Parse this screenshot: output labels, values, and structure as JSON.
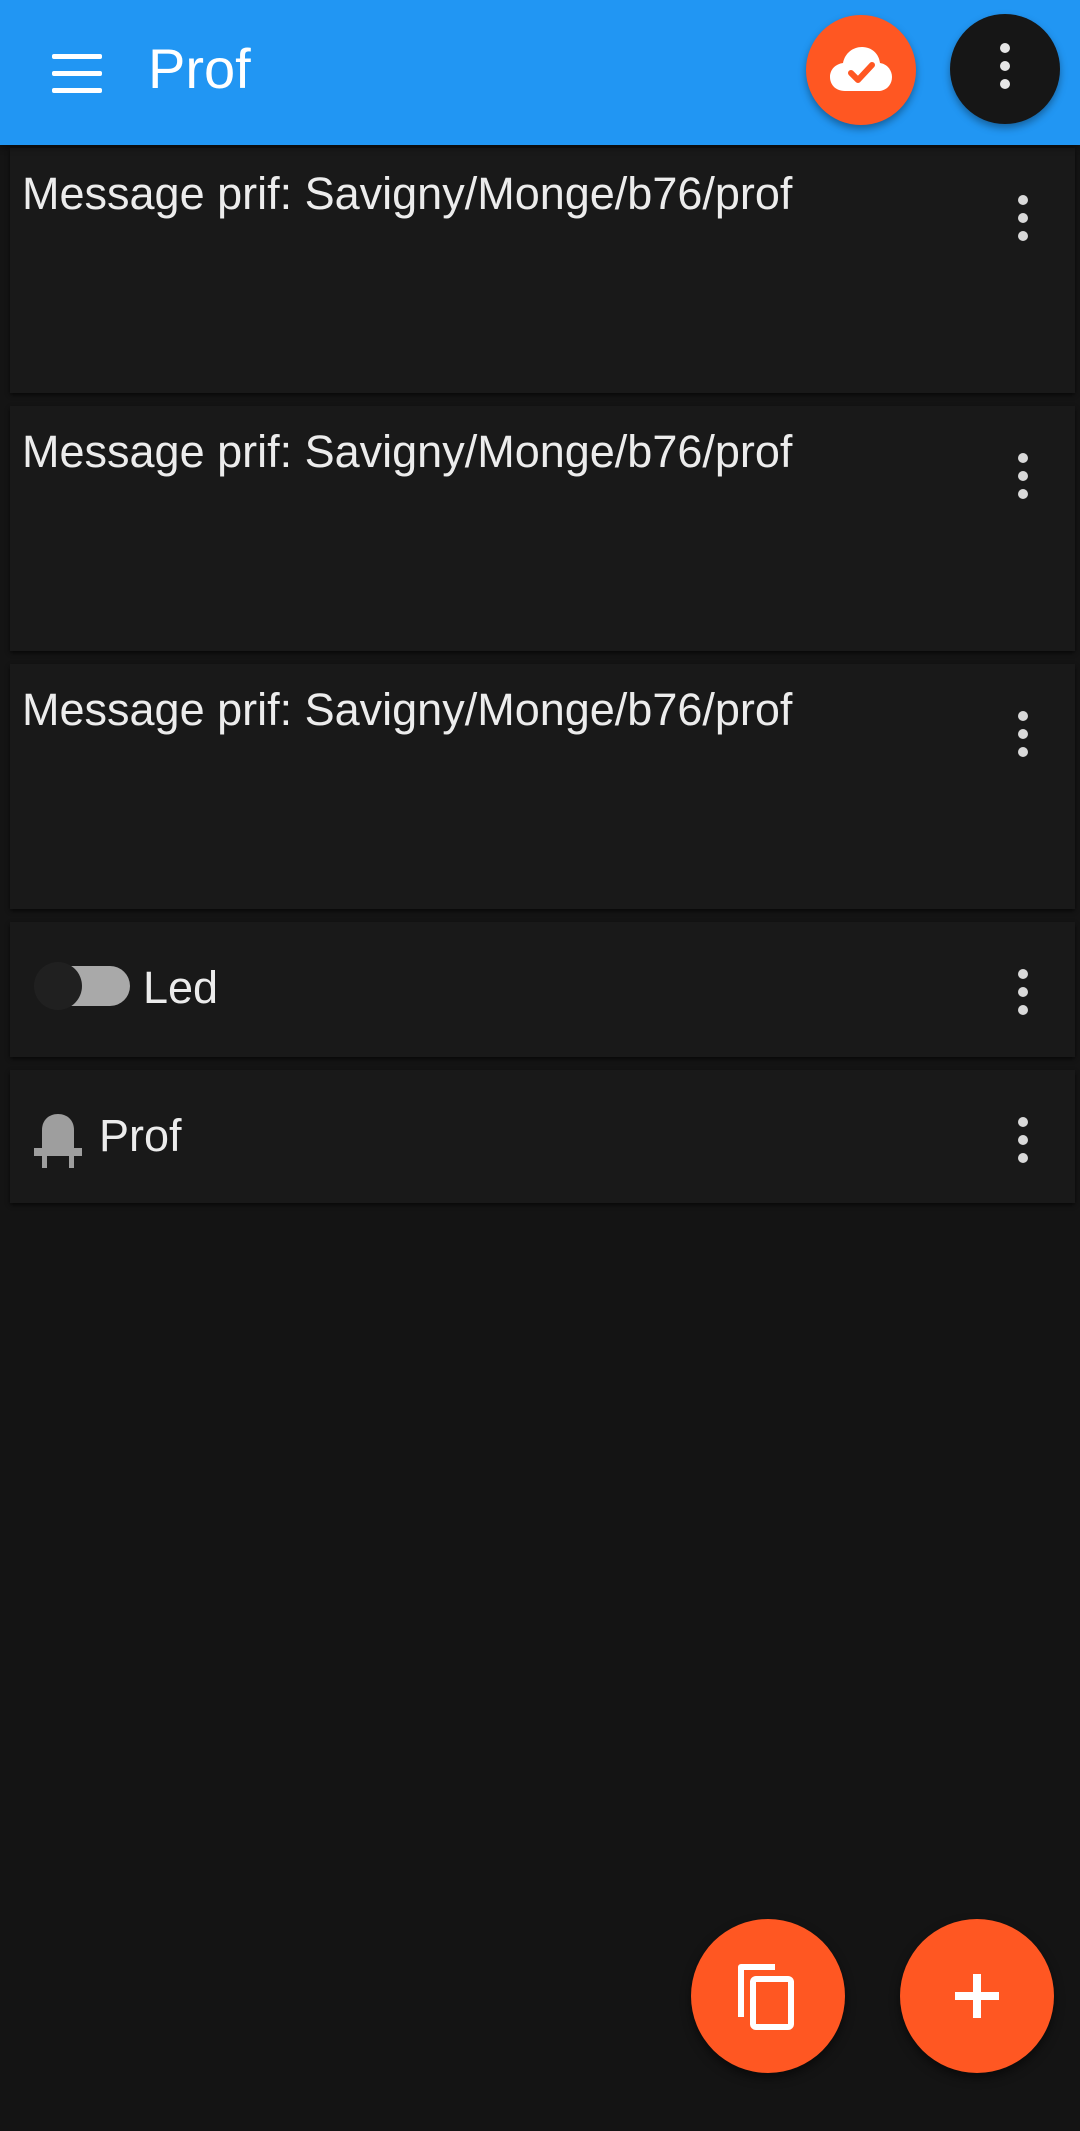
{
  "app_bar": {
    "title": "Prof",
    "menu_icon": "hamburger-menu-icon",
    "cloud_icon": "cloud-check-icon",
    "overflow_icon": "more-vertical-icon",
    "color": "#2196F3",
    "accent": "#FF5722"
  },
  "cards": [
    {
      "type": "message",
      "text": "Message prif: Savigny/Monge/b76/prof"
    },
    {
      "type": "message",
      "text": "Message prif: Savigny/Monge/b76/prof"
    },
    {
      "type": "message",
      "text": "Message prif: Savigny/Monge/b76/prof"
    },
    {
      "type": "switch",
      "label": "Led",
      "state": "off"
    },
    {
      "type": "notification",
      "label": "Prof",
      "icon": "bell-icon"
    }
  ],
  "fabs": {
    "copy_icon": "copy-icon",
    "add_icon": "plus-icon"
  },
  "colors": {
    "background": "#141414",
    "card": "#191919",
    "text": "#ececec"
  }
}
